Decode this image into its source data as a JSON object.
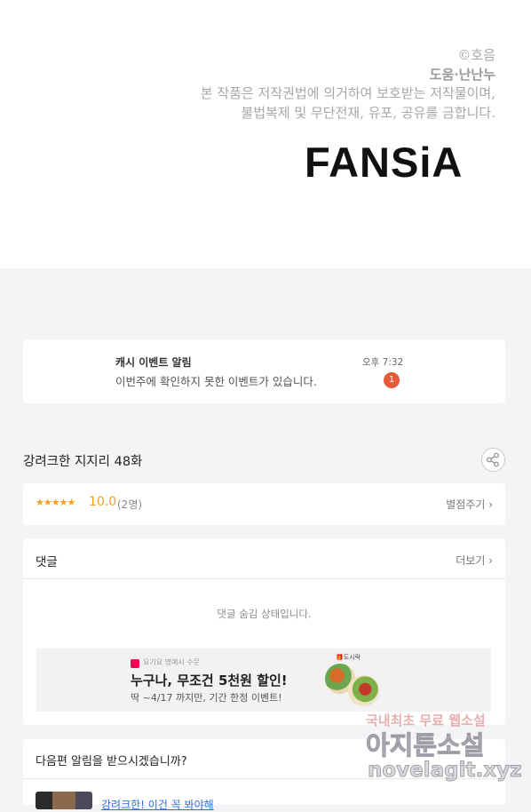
{
  "credits": {
    "copyright": "©호음",
    "helper": "도움·난난누",
    "notice_line1": "본 작품은 저작권법에 의거하여 보호받는 저작물이며,",
    "notice_line2": "불법복제 및 무단전재, 유포, 공유를 금합니다.",
    "logo_text": "FANSiA"
  },
  "notification": {
    "title": "캐시 이벤트 알림",
    "body": "이번주에 확인하지 못한 이벤트가 있습니다.",
    "time": "오후 7:32",
    "badge": "1"
  },
  "episode": {
    "title": "강려크한 지지리 48화",
    "share_icon": "share-icon"
  },
  "rating": {
    "stars": "★★★★★",
    "score": "10.0",
    "count": "(2명)",
    "rate_link": "별점주기 ›"
  },
  "comments": {
    "title": "댓글",
    "more_link": "더보기 ›",
    "hidden_message": "댓글 숨김 상태입니다."
  },
  "ad": {
    "brand": "요기요 명예시 수문",
    "title": "누구나, 무조건 5천원 할인!",
    "subtitle": "딱 ~4/17 까지만, 기간 한정 이벤트!",
    "tag": "🎁도시락"
  },
  "subscribe": {
    "title": "다음편 알림을 받으시겠습니까?",
    "next_link": "강려크한! 이건 꼭 봐야해"
  },
  "watermark": {
    "line1": "국내최초 무료 웹소설",
    "line2": "아지툰소설",
    "line3": "novelagit.xyz"
  },
  "colors": {
    "accent_star": "#f2a11c",
    "badge": "#e65a3c",
    "link": "#2d6fd6"
  }
}
